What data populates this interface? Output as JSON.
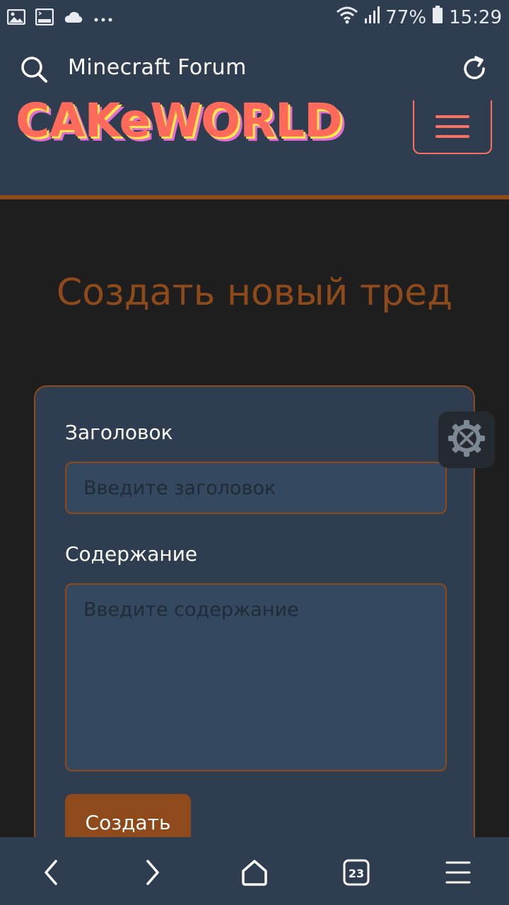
{
  "status_bar": {
    "battery_percent": "77%",
    "time": "15:29",
    "icons": [
      "image-icon",
      "terminal-icon",
      "cloud-icon",
      "more-dots-icon",
      "wifi-icon",
      "signal-icon",
      "battery-icon"
    ]
  },
  "browser": {
    "site_title": "Minecraft Forum",
    "search_icon": "search-icon",
    "reload_icon": "reload-icon"
  },
  "site": {
    "logo_text": "CAKeWORLD",
    "menu_icon": "hamburger-menu-icon",
    "accent_color": "#8e4a1a",
    "logo_color": "#ff6a5a"
  },
  "main": {
    "heading": "Создать новый тред",
    "form": {
      "title_label": "Заголовок",
      "title_placeholder": "Введите заголовок",
      "title_value": "",
      "content_label": "Содержание",
      "content_placeholder": "Введите содержание",
      "content_value": "",
      "submit_label": "Создать"
    },
    "floating_tool_icon": "settings-tools-icon"
  },
  "bottom_nav": {
    "tabs_count": "23",
    "icons": [
      "back-icon",
      "forward-icon",
      "home-icon",
      "tabs-icon",
      "menu-icon"
    ]
  }
}
